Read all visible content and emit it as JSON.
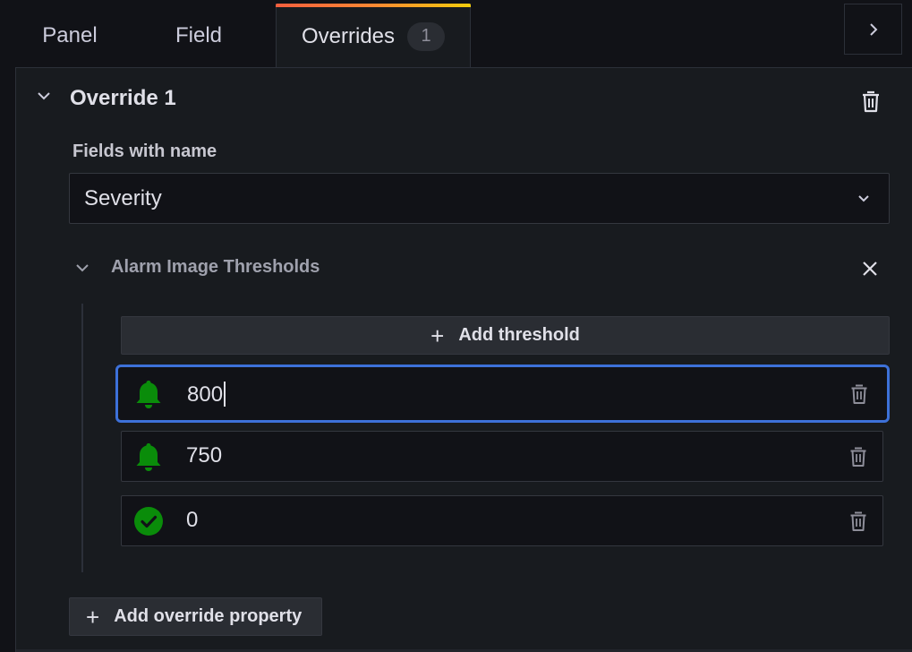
{
  "tabs": [
    {
      "label": "Panel"
    },
    {
      "label": "Field"
    },
    {
      "label": "Overrides",
      "count": "1",
      "active": true
    }
  ],
  "override": {
    "title": "Override 1",
    "matcher_label": "Fields with name",
    "matcher_value": "Severity",
    "property": {
      "title": "Alarm Image Thresholds",
      "add_threshold_label": "Add threshold",
      "thresholds": [
        {
          "value": "800",
          "icon": "bell-icon",
          "color": "#0a8c0a",
          "focused": true
        },
        {
          "value": "750",
          "icon": "bell-icon",
          "color": "#0a8c0a"
        },
        {
          "value": "0",
          "icon": "check-circle-icon",
          "color": "#0a8c0a"
        }
      ]
    },
    "add_property_label": "Add override property"
  },
  "colors": {
    "accent_focus": "#3d71d9",
    "threshold_green": "#0a8c0a"
  }
}
